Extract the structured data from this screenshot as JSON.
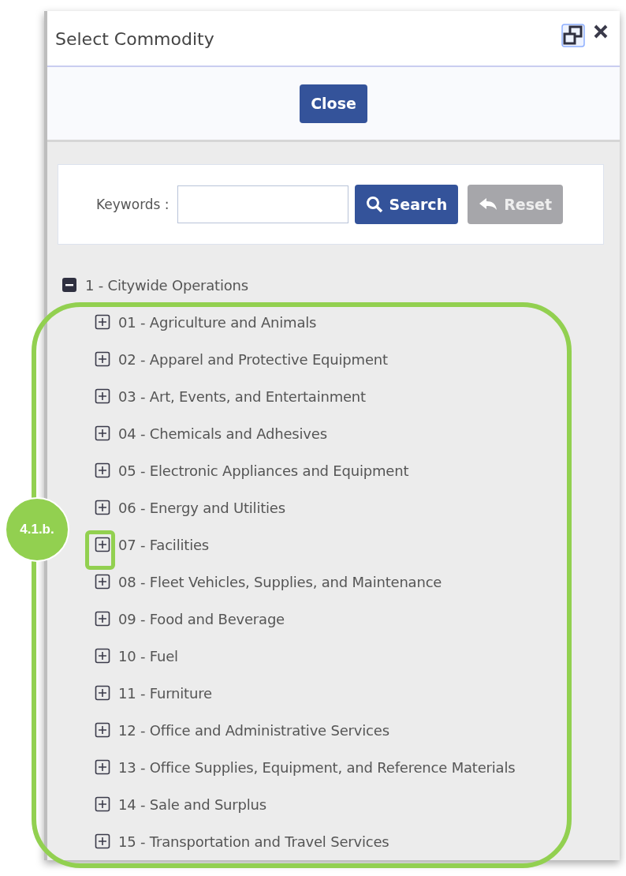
{
  "window": {
    "title": "Select Commodity"
  },
  "toolbar": {
    "close_button": "Close"
  },
  "search": {
    "label": "Keywords :",
    "search_button": "Search",
    "reset_button": "Reset",
    "reset_disabled": true
  },
  "tree": [
    {
      "label": "1 - Citywide Operations",
      "expanded": true,
      "children": [
        {
          "label": "01 - Agriculture and Animals",
          "expanded": false,
          "highlighted": false
        },
        {
          "label": "02 - Apparel and Protective Equipment",
          "expanded": false,
          "highlighted": false
        },
        {
          "label": "03 - Art, Events, and Entertainment",
          "expanded": false,
          "highlighted": false
        },
        {
          "label": "04 - Chemicals and Adhesives",
          "expanded": false,
          "highlighted": false
        },
        {
          "label": "05 - Electronic Appliances and Equipment",
          "expanded": false,
          "highlighted": false
        },
        {
          "label": "06 - Energy and Utilities",
          "expanded": false,
          "highlighted": false
        },
        {
          "label": "07 - Facilities",
          "expanded": false,
          "highlighted": true
        },
        {
          "label": "08 - Fleet Vehicles, Supplies, and Maintenance",
          "expanded": false,
          "highlighted": false
        },
        {
          "label": "09 - Food and Beverage",
          "expanded": false,
          "highlighted": false
        },
        {
          "label": "10 - Fuel",
          "expanded": false,
          "highlighted": false
        },
        {
          "label": "11 - Furniture",
          "expanded": false,
          "highlighted": false
        },
        {
          "label": "12 - Office and Administrative Services",
          "expanded": false,
          "highlighted": false
        },
        {
          "label": "13 - Office Supplies, Equipment, and Reference Materials",
          "expanded": false,
          "highlighted": false
        },
        {
          "label": "14 - Sale and Surplus",
          "expanded": false,
          "highlighted": false
        },
        {
          "label": "15 - Transportation and Travel Services",
          "expanded": false,
          "highlighted": false
        }
      ]
    }
  ],
  "annotation": {
    "badge": "4.1.b."
  }
}
